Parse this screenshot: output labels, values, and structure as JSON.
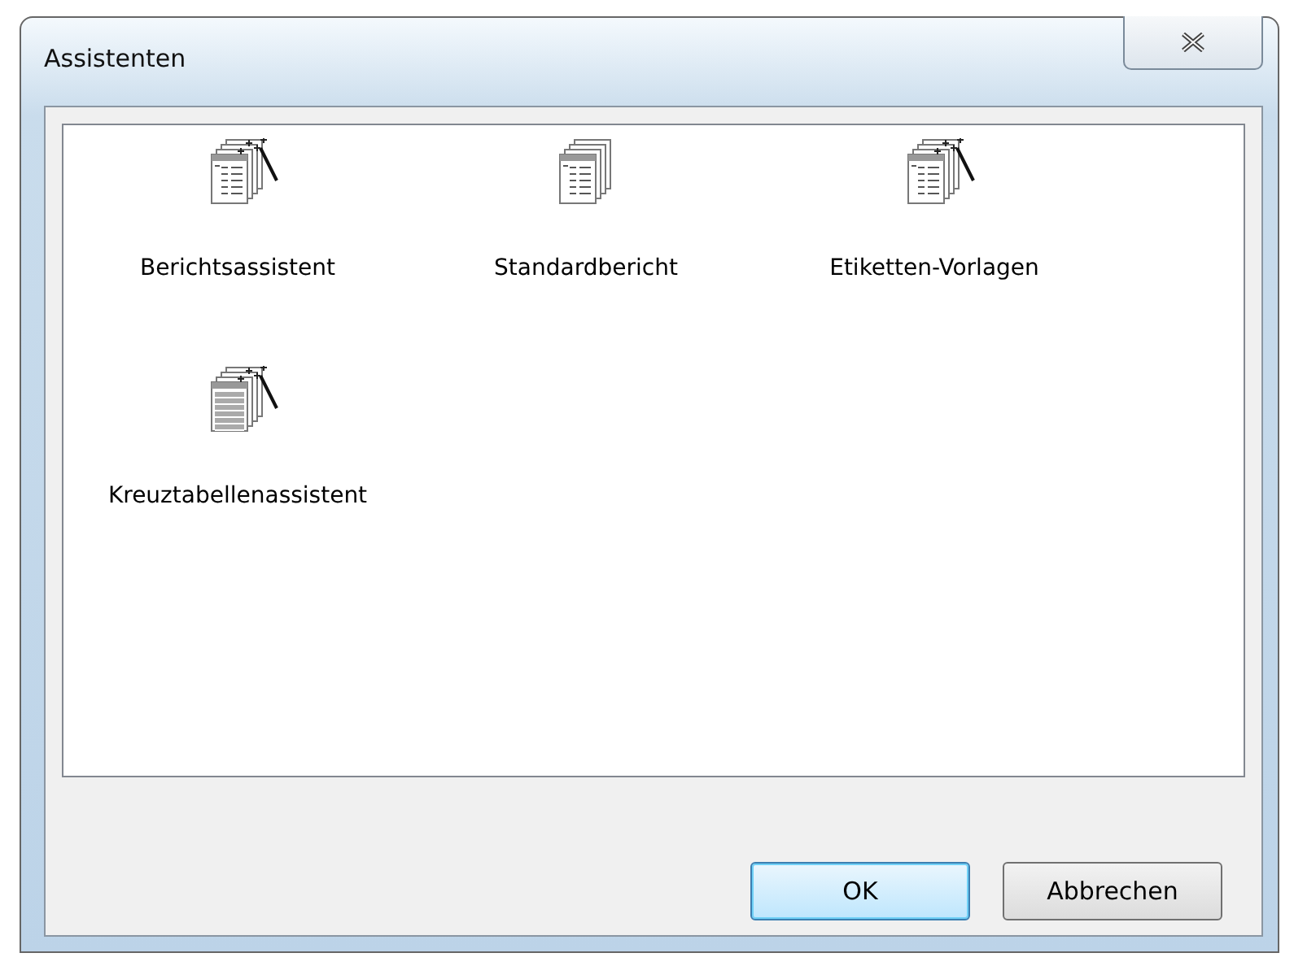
{
  "window": {
    "title": "Assistenten"
  },
  "items": [
    {
      "label": "Berichtsassistent",
      "kind": "wizard"
    },
    {
      "label": "Standardbericht",
      "kind": "report"
    },
    {
      "label": "Etiketten-Vorlagen",
      "kind": "wizard"
    },
    {
      "label": "Kreuztabellenassistent",
      "kind": "crosstab"
    }
  ],
  "buttons": [
    {
      "label": "OK",
      "default": true
    },
    {
      "label": "Abbrechen",
      "default": false
    }
  ]
}
